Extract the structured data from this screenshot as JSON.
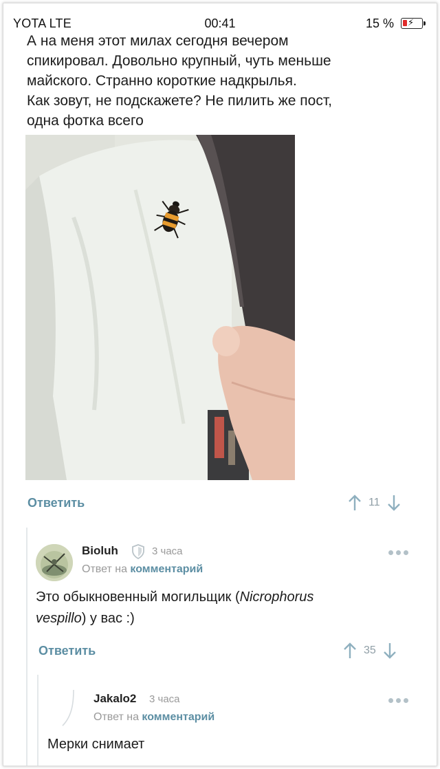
{
  "status_bar": {
    "carrier": "YOTA LTE",
    "time": "00:41",
    "battery": "15 %"
  },
  "post": {
    "lines": [
      "А на меня этот милах сегодня вечером",
      "спикировал. Довольно крупный, чуть меньше",
      "майского. Странно короткие надкрылья.",
      "Как зовут, не подскажете? Не пилить же пост,",
      "одна фотка всего"
    ],
    "reply_label": "Ответить",
    "votes": "11"
  },
  "comment1": {
    "author": "Bioluh",
    "time": "3 часа",
    "reply_to_prefix": "Ответ на",
    "reply_to_link": "комментарий",
    "text_before": "Это обыкновенный могильщик (",
    "text_italic_1": "Nicrophorus",
    "text_italic_2": "vespillo",
    "text_after": ") у вас :)",
    "reply_label": "Ответить",
    "votes": "35"
  },
  "comment2": {
    "author": "Jakalo2",
    "time": "3 часа",
    "reply_to_prefix": "Ответ на",
    "reply_to_link": "комментарий",
    "text": "Мерки снимает"
  },
  "colors": {
    "link": "#5c8ea3",
    "battery_low": "#e02b2b",
    "muted": "#999999"
  },
  "icons": [
    "battery-icon",
    "shield-icon",
    "arrow-up-icon",
    "arrow-down-icon",
    "more-dots-icon"
  ]
}
